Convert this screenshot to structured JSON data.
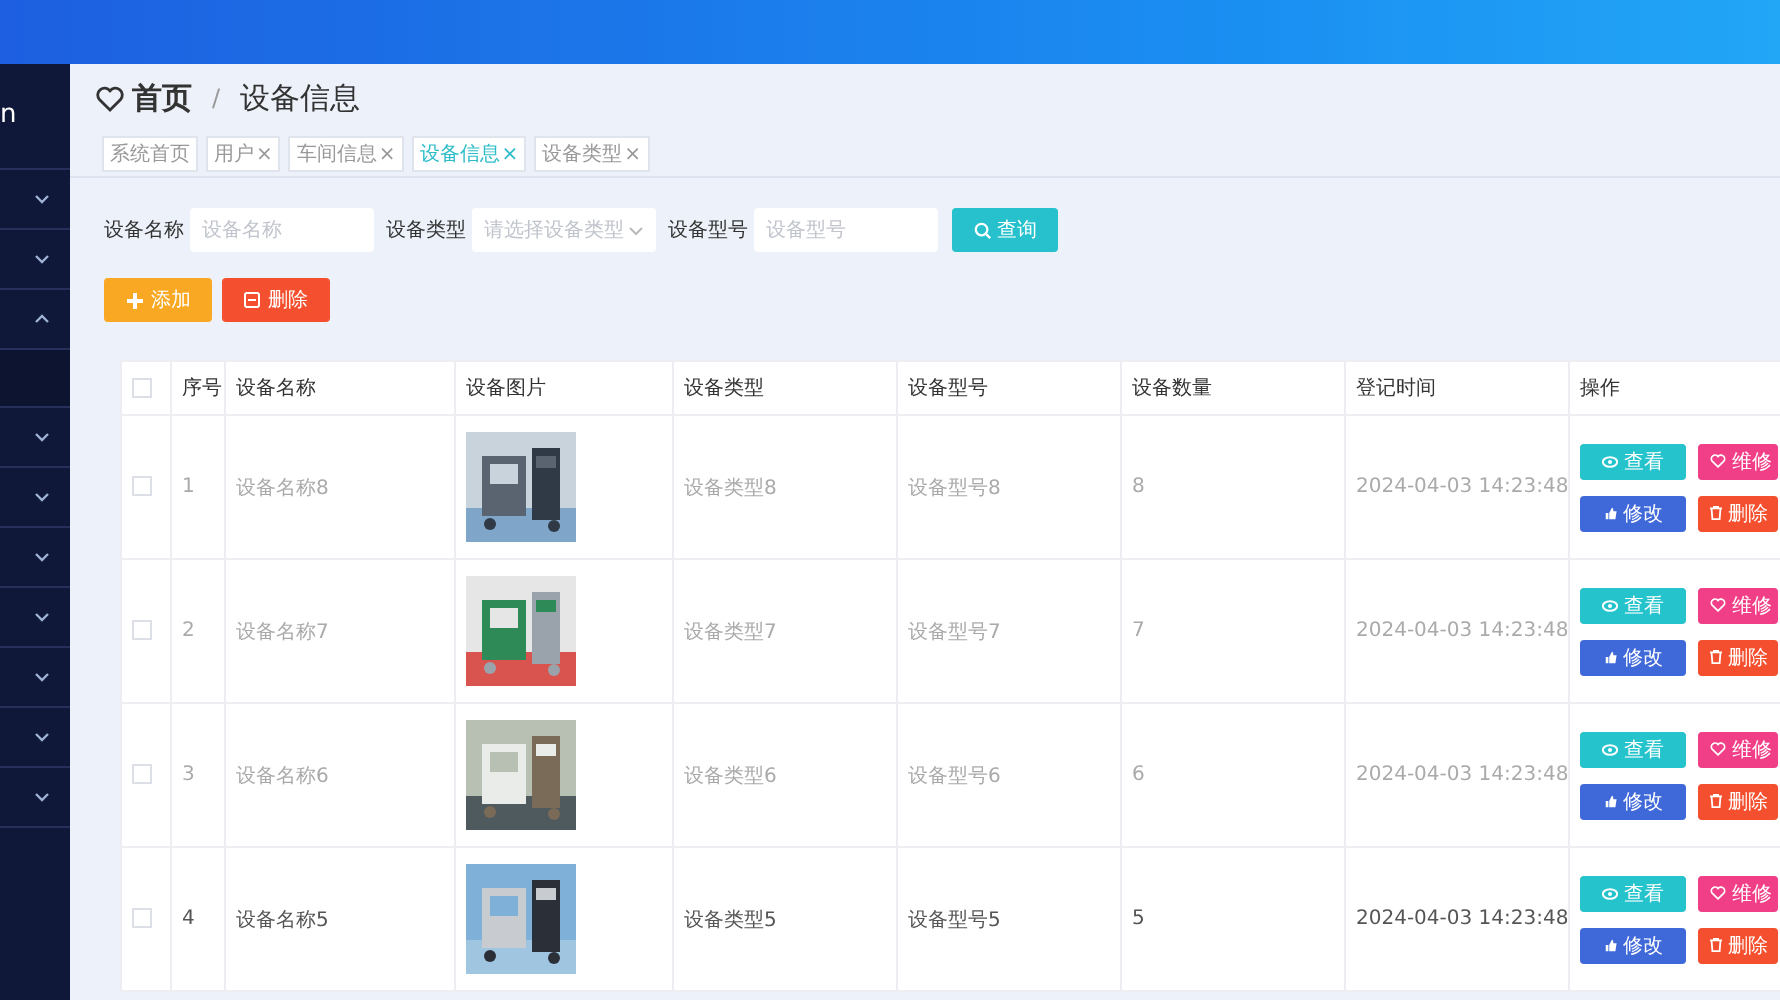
{
  "sidebar": {
    "title": "n",
    "items": [
      {
        "expanded": false
      },
      {
        "expanded": false
      },
      {
        "expanded": true
      },
      {
        "expanded": false
      },
      {
        "expanded": false
      },
      {
        "expanded": false
      },
      {
        "expanded": false
      },
      {
        "expanded": false
      },
      {
        "expanded": false
      },
      {
        "expanded": false
      }
    ]
  },
  "breadcrumb": {
    "home": "首页",
    "separator": "/",
    "current": "设备信息"
  },
  "tabs": [
    {
      "label": "系统首页",
      "selected": false
    },
    {
      "label": "用户",
      "close": "×",
      "selected": false
    },
    {
      "label": "车间信息",
      "close": "×",
      "selected": false
    },
    {
      "label": "设备信息",
      "close": "×",
      "selected": true
    },
    {
      "label": "设备类型",
      "close": "×",
      "selected": false
    }
  ],
  "filters": [
    {
      "kind": "input",
      "label": "设备名称",
      "placeholder": "设备名称"
    },
    {
      "kind": "select",
      "label": "设备类型",
      "placeholder": "请选择设备类型"
    },
    {
      "kind": "input",
      "label": "设备型号",
      "placeholder": "设备型号"
    }
  ],
  "search_button": "查询",
  "actions": {
    "add": "添加",
    "delete": "删除"
  },
  "table": {
    "columns": {
      "index": "序号",
      "name": "设备名称",
      "picture": "设备图片",
      "type": "设备类型",
      "model": "设备型号",
      "quantity": "设备数量",
      "time": "登记时间",
      "actions": "操作"
    },
    "header_checked": false,
    "rows": [
      {
        "checked": false,
        "hovered": false,
        "index": "1",
        "name": "设备名称8",
        "picture": {
          "kind": "picture"
        },
        "type": "设备类型8",
        "model": "设备型号8",
        "quantity": "8",
        "time": "2024-04-03 14:23:48",
        "buttons": [
          {
            "kind": "view",
            "label": "查看"
          },
          {
            "kind": "repair",
            "label": "维修"
          },
          {
            "kind": "edit",
            "label": "修改"
          },
          {
            "kind": "delete",
            "label": "删除"
          }
        ]
      },
      {
        "checked": false,
        "hovered": false,
        "index": "2",
        "name": "设备名称7",
        "picture": {
          "kind": "picture"
        },
        "type": "设备类型7",
        "model": "设备型号7",
        "quantity": "7",
        "time": "2024-04-03 14:23:48",
        "buttons": [
          {
            "kind": "view",
            "label": "查看"
          },
          {
            "kind": "repair",
            "label": "维修"
          },
          {
            "kind": "edit",
            "label": "修改"
          },
          {
            "kind": "delete",
            "label": "删除"
          }
        ]
      },
      {
        "checked": false,
        "hovered": false,
        "index": "3",
        "name": "设备名称6",
        "picture": {
          "kind": "picture"
        },
        "type": "设备类型6",
        "model": "设备型号6",
        "quantity": "6",
        "time": "2024-04-03 14:23:48",
        "buttons": [
          {
            "kind": "view",
            "label": "查看"
          },
          {
            "kind": "repair",
            "label": "维修"
          },
          {
            "kind": "edit",
            "label": "修改"
          },
          {
            "kind": "delete",
            "label": "删除"
          }
        ]
      },
      {
        "checked": false,
        "hovered": true,
        "index": "4",
        "name": "设备名称5",
        "picture": {
          "kind": "picture"
        },
        "type": "设备类型5",
        "model": "设备型号5",
        "quantity": "5",
        "time": "2024-04-03 14:23:48",
        "buttons": [
          {
            "kind": "view",
            "label": "查看"
          },
          {
            "kind": "repair",
            "label": "维修"
          },
          {
            "kind": "edit",
            "label": "修改"
          },
          {
            "kind": "delete",
            "label": "删除"
          }
        ]
      }
    ]
  }
}
